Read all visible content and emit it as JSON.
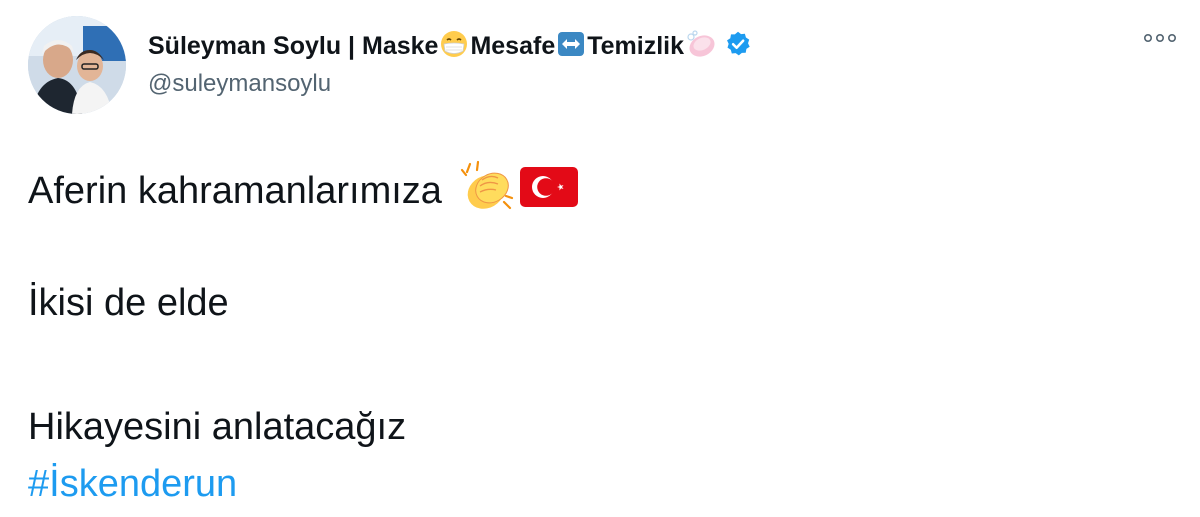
{
  "author": {
    "name_parts": [
      "Süleyman Soylu | Maske",
      "Mesafe",
      "Temizlik"
    ],
    "handle": "@suleymansoylu",
    "verified": true
  },
  "icons": {
    "avatar": "profile-photo",
    "name_emoji_1": "face-with-medical-mask",
    "name_emoji_2": "left-right-arrow",
    "name_emoji_3": "soap",
    "verified_badge": "verified-badge",
    "more": "more-options",
    "clap": "clapping-hands",
    "flag": "turkey-flag"
  },
  "tweet": {
    "line1": "Aferin kahramanlarımıza",
    "line2": "İkisi de elde",
    "line3": "Hikayesini anlatacağız",
    "hashtag": "#İskenderun"
  },
  "colors": {
    "link": "#1d9bf0",
    "verified": "#1d9bf0",
    "text": "#0f1419",
    "secondary": "#536471"
  }
}
